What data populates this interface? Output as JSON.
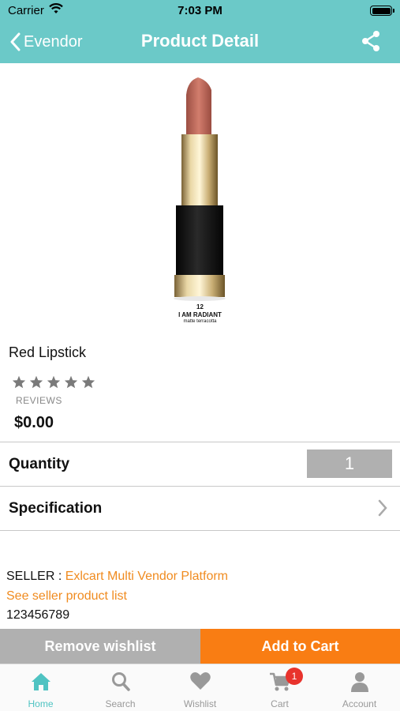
{
  "status_bar": {
    "carrier": "Carrier",
    "time": "7:03 PM"
  },
  "nav": {
    "back_label": "Evendor",
    "title": "Product Detail"
  },
  "product_image": {
    "number": "12",
    "shade_name": "I AM RADIANT",
    "finish": "matte terracotta"
  },
  "product": {
    "name": "Red Lipstick",
    "rating": 0,
    "rating_max": 5,
    "reviews_label": "REVIEWS",
    "price": "$0.00"
  },
  "quantity": {
    "label": "Quantity",
    "value": "1"
  },
  "specification": {
    "label": "Specification"
  },
  "seller": {
    "prefix": "SELLER : ",
    "name": "Exlcart Multi Vendor Platform",
    "link": "See seller product list",
    "phone": "123456789"
  },
  "actions": {
    "remove_wishlist": "Remove wishlist",
    "add_to_cart": "Add to Cart"
  },
  "colors": {
    "header": "#6bc9c8",
    "accent": "#f97d13",
    "link": "#f08b1f",
    "active_tab": "#4fc3c2",
    "badge": "#e8332d"
  },
  "tabbar": {
    "home": "Home",
    "search": "Search",
    "wishlist": "Wishlist",
    "cart": "Cart",
    "cart_badge": "1",
    "account": "Account"
  }
}
